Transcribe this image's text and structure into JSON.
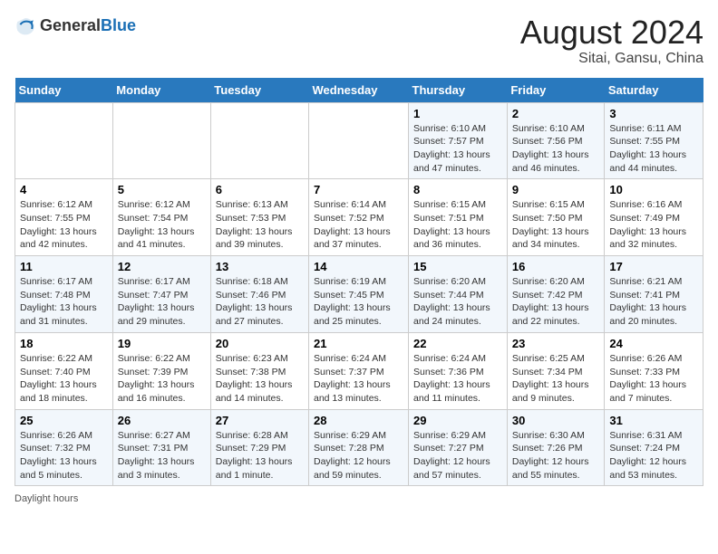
{
  "header": {
    "logo_general": "General",
    "logo_blue": "Blue",
    "month_year": "August 2024",
    "location": "Sitai, Gansu, China"
  },
  "days_of_week": [
    "Sunday",
    "Monday",
    "Tuesday",
    "Wednesday",
    "Thursday",
    "Friday",
    "Saturday"
  ],
  "weeks": [
    [
      {
        "day": "",
        "info": ""
      },
      {
        "day": "",
        "info": ""
      },
      {
        "day": "",
        "info": ""
      },
      {
        "day": "",
        "info": ""
      },
      {
        "day": "1",
        "info": "Sunrise: 6:10 AM\nSunset: 7:57 PM\nDaylight: 13 hours and 47 minutes."
      },
      {
        "day": "2",
        "info": "Sunrise: 6:10 AM\nSunset: 7:56 PM\nDaylight: 13 hours and 46 minutes."
      },
      {
        "day": "3",
        "info": "Sunrise: 6:11 AM\nSunset: 7:55 PM\nDaylight: 13 hours and 44 minutes."
      }
    ],
    [
      {
        "day": "4",
        "info": "Sunrise: 6:12 AM\nSunset: 7:55 PM\nDaylight: 13 hours and 42 minutes."
      },
      {
        "day": "5",
        "info": "Sunrise: 6:12 AM\nSunset: 7:54 PM\nDaylight: 13 hours and 41 minutes."
      },
      {
        "day": "6",
        "info": "Sunrise: 6:13 AM\nSunset: 7:53 PM\nDaylight: 13 hours and 39 minutes."
      },
      {
        "day": "7",
        "info": "Sunrise: 6:14 AM\nSunset: 7:52 PM\nDaylight: 13 hours and 37 minutes."
      },
      {
        "day": "8",
        "info": "Sunrise: 6:15 AM\nSunset: 7:51 PM\nDaylight: 13 hours and 36 minutes."
      },
      {
        "day": "9",
        "info": "Sunrise: 6:15 AM\nSunset: 7:50 PM\nDaylight: 13 hours and 34 minutes."
      },
      {
        "day": "10",
        "info": "Sunrise: 6:16 AM\nSunset: 7:49 PM\nDaylight: 13 hours and 32 minutes."
      }
    ],
    [
      {
        "day": "11",
        "info": "Sunrise: 6:17 AM\nSunset: 7:48 PM\nDaylight: 13 hours and 31 minutes."
      },
      {
        "day": "12",
        "info": "Sunrise: 6:17 AM\nSunset: 7:47 PM\nDaylight: 13 hours and 29 minutes."
      },
      {
        "day": "13",
        "info": "Sunrise: 6:18 AM\nSunset: 7:46 PM\nDaylight: 13 hours and 27 minutes."
      },
      {
        "day": "14",
        "info": "Sunrise: 6:19 AM\nSunset: 7:45 PM\nDaylight: 13 hours and 25 minutes."
      },
      {
        "day": "15",
        "info": "Sunrise: 6:20 AM\nSunset: 7:44 PM\nDaylight: 13 hours and 24 minutes."
      },
      {
        "day": "16",
        "info": "Sunrise: 6:20 AM\nSunset: 7:42 PM\nDaylight: 13 hours and 22 minutes."
      },
      {
        "day": "17",
        "info": "Sunrise: 6:21 AM\nSunset: 7:41 PM\nDaylight: 13 hours and 20 minutes."
      }
    ],
    [
      {
        "day": "18",
        "info": "Sunrise: 6:22 AM\nSunset: 7:40 PM\nDaylight: 13 hours and 18 minutes."
      },
      {
        "day": "19",
        "info": "Sunrise: 6:22 AM\nSunset: 7:39 PM\nDaylight: 13 hours and 16 minutes."
      },
      {
        "day": "20",
        "info": "Sunrise: 6:23 AM\nSunset: 7:38 PM\nDaylight: 13 hours and 14 minutes."
      },
      {
        "day": "21",
        "info": "Sunrise: 6:24 AM\nSunset: 7:37 PM\nDaylight: 13 hours and 13 minutes."
      },
      {
        "day": "22",
        "info": "Sunrise: 6:24 AM\nSunset: 7:36 PM\nDaylight: 13 hours and 11 minutes."
      },
      {
        "day": "23",
        "info": "Sunrise: 6:25 AM\nSunset: 7:34 PM\nDaylight: 13 hours and 9 minutes."
      },
      {
        "day": "24",
        "info": "Sunrise: 6:26 AM\nSunset: 7:33 PM\nDaylight: 13 hours and 7 minutes."
      }
    ],
    [
      {
        "day": "25",
        "info": "Sunrise: 6:26 AM\nSunset: 7:32 PM\nDaylight: 13 hours and 5 minutes."
      },
      {
        "day": "26",
        "info": "Sunrise: 6:27 AM\nSunset: 7:31 PM\nDaylight: 13 hours and 3 minutes."
      },
      {
        "day": "27",
        "info": "Sunrise: 6:28 AM\nSunset: 7:29 PM\nDaylight: 13 hours and 1 minute."
      },
      {
        "day": "28",
        "info": "Sunrise: 6:29 AM\nSunset: 7:28 PM\nDaylight: 12 hours and 59 minutes."
      },
      {
        "day": "29",
        "info": "Sunrise: 6:29 AM\nSunset: 7:27 PM\nDaylight: 12 hours and 57 minutes."
      },
      {
        "day": "30",
        "info": "Sunrise: 6:30 AM\nSunset: 7:26 PM\nDaylight: 12 hours and 55 minutes."
      },
      {
        "day": "31",
        "info": "Sunrise: 6:31 AM\nSunset: 7:24 PM\nDaylight: 12 hours and 53 minutes."
      }
    ]
  ],
  "footer": {
    "daylight_label": "Daylight hours"
  }
}
